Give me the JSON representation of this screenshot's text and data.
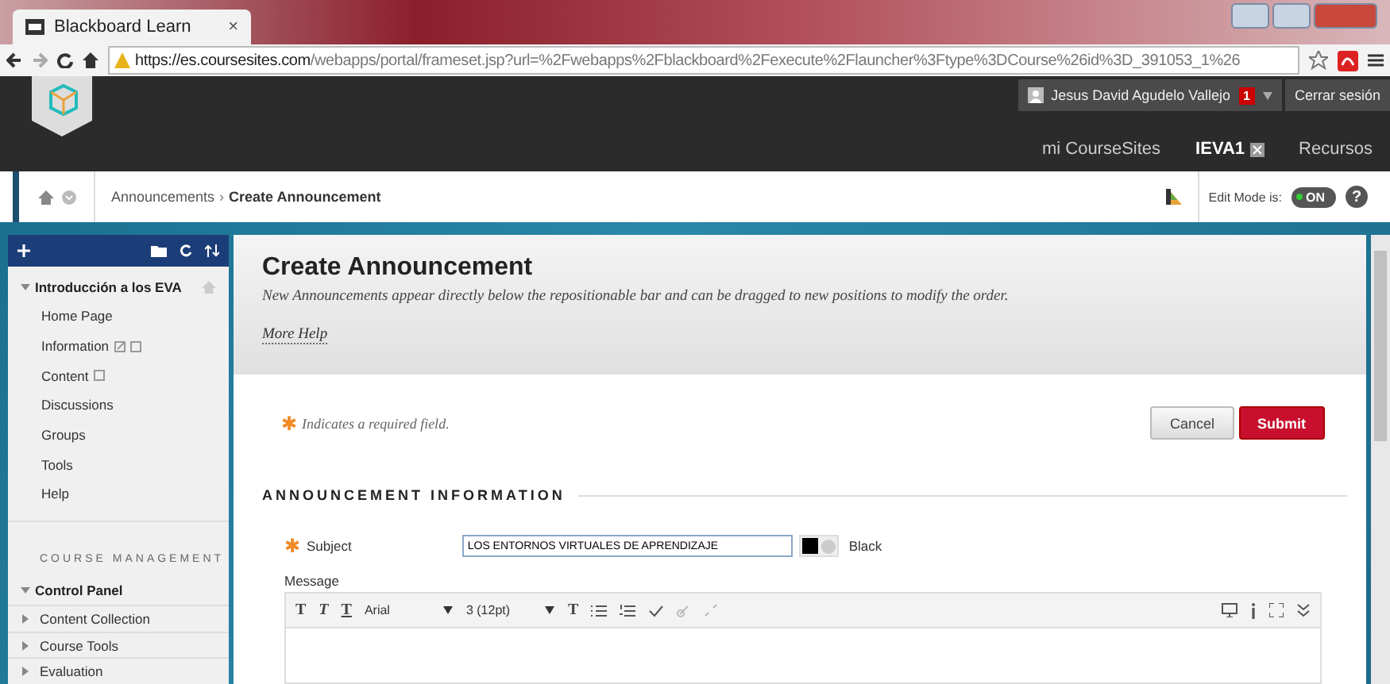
{
  "browser": {
    "tab_title": "Blackboard Learn",
    "tab_close": "×",
    "url_host": "https://es.coursesites.com",
    "url_path": "/webapps/portal/frameset.jsp?url=%2Fwebapps%2Fblackboard%2Fexecute%2Flauncher%3Ftype%3DCourse%26id%3D_391053_1%26"
  },
  "header": {
    "user_name": "Jesus David Agudelo Vallejo",
    "notifications": "1",
    "logout": "Cerrar sesión",
    "nav_tabs": [
      {
        "label": "mi CourseSites",
        "selected": false
      },
      {
        "label": "IEVA1",
        "selected": true
      },
      {
        "label": "Recursos",
        "selected": false
      }
    ]
  },
  "breadcrumb": {
    "items": [
      "Announcements",
      "Create Announcement"
    ],
    "separator": "›",
    "help": "?",
    "edit_mode_label": "Edit Mode is:",
    "edit_mode": {
      "on": true,
      "label": "ON"
    }
  },
  "sidebar": {
    "course": {
      "title": "Introducción a los EVA",
      "expanded": true,
      "items": [
        {
          "label": "Home Page",
          "kind": "plain"
        },
        {
          "label": "Information",
          "kind": "linked"
        },
        {
          "label": "Content",
          "kind": "empty"
        },
        {
          "label": "Discussions",
          "kind": "plain"
        },
        {
          "label": "Groups",
          "kind": "plain"
        },
        {
          "label": "Tools",
          "kind": "plain"
        },
        {
          "label": "Help",
          "kind": "plain"
        }
      ]
    },
    "management": {
      "heading": "COURSE MANAGEMENT",
      "title": "Control Panel",
      "expanded": true,
      "children": [
        {
          "label": "Content Collection",
          "expanded": false
        },
        {
          "label": "Course Tools",
          "expanded": false
        },
        {
          "label": "Evaluation",
          "expanded": false
        }
      ]
    }
  },
  "page": {
    "title": "Create Announcement",
    "description": "New Announcements appear directly below the repositionable bar and can be dragged to new positions to modify the order.",
    "more_help": "More Help",
    "required_mark": "✱",
    "required_note": "Indicates a required field.",
    "buttons": [
      {
        "label": "Cancel",
        "kind": "secondary"
      },
      {
        "label": "Submit",
        "kind": "primary"
      }
    ],
    "section_title": "ANNOUNCEMENT INFORMATION",
    "subject_required_mark": "✱",
    "subject_label": "Subject",
    "subject_value": "LOS ENTORNOS VIRTUALES DE APRENDIZAJE",
    "subject_color": {
      "name": "Black",
      "color": "#000000"
    },
    "message_label": "Message",
    "editor": {
      "format_buttons": [
        {
          "label": "T",
          "kind": "bold"
        },
        {
          "label": "T",
          "kind": "italic"
        },
        {
          "label": "T",
          "kind": "underline"
        }
      ],
      "font": "Arial",
      "size": "3 (12pt)",
      "text_format": "T"
    }
  }
}
